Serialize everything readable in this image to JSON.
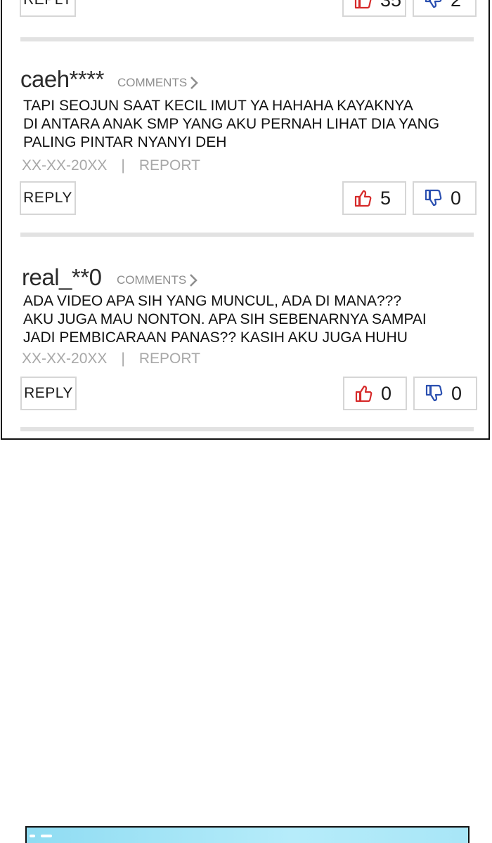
{
  "top_partial": {
    "reply_label": "REPLY",
    "likes": "35",
    "dislikes": "2"
  },
  "comments": [
    {
      "username": "caeh****",
      "comments_link": "COMMENTS",
      "text": "TAPI SEOJUN SAAT KECIL IMUT YA HAHAHA KAYAKNYA\nDI ANTARA ANAK SMP YANG AKU PERNAH LIHAT DIA YANG\nPALING PINTAR NYANYI  DEH",
      "date": "XX-XX-20XX",
      "separator": "|",
      "report": "REPORT",
      "reply_label": "REPLY",
      "likes": "5",
      "dislikes": "0"
    },
    {
      "username": "real_**0",
      "comments_link": "COMMENTS",
      "text": "ADA VIDEO APA SIH YANG MUNCUL, ADA DI MANA???\nAKU JUGA MAU NONTON. APA SIH SEBENARNYA SAMPAI\nJADI PEMBICARAAN PANAS?? KASIH AKU JUGA HUHU",
      "date": "XX-XX-20XX",
      "separator": "|",
      "report": "REPORT",
      "reply_label": "REPLY",
      "likes": "0",
      "dislikes": "0"
    }
  ],
  "icons": {
    "like": "thumbs-up-icon",
    "dislike": "thumbs-down-icon",
    "chevron": "chevron-right-icon"
  },
  "colors": {
    "like_icon": "#d62a2a",
    "dislike_icon": "#2a4fb0",
    "divider": "#e2e2e2",
    "meta_text": "#a8a8a8",
    "next_panel_sky": "#9fe2f5"
  }
}
